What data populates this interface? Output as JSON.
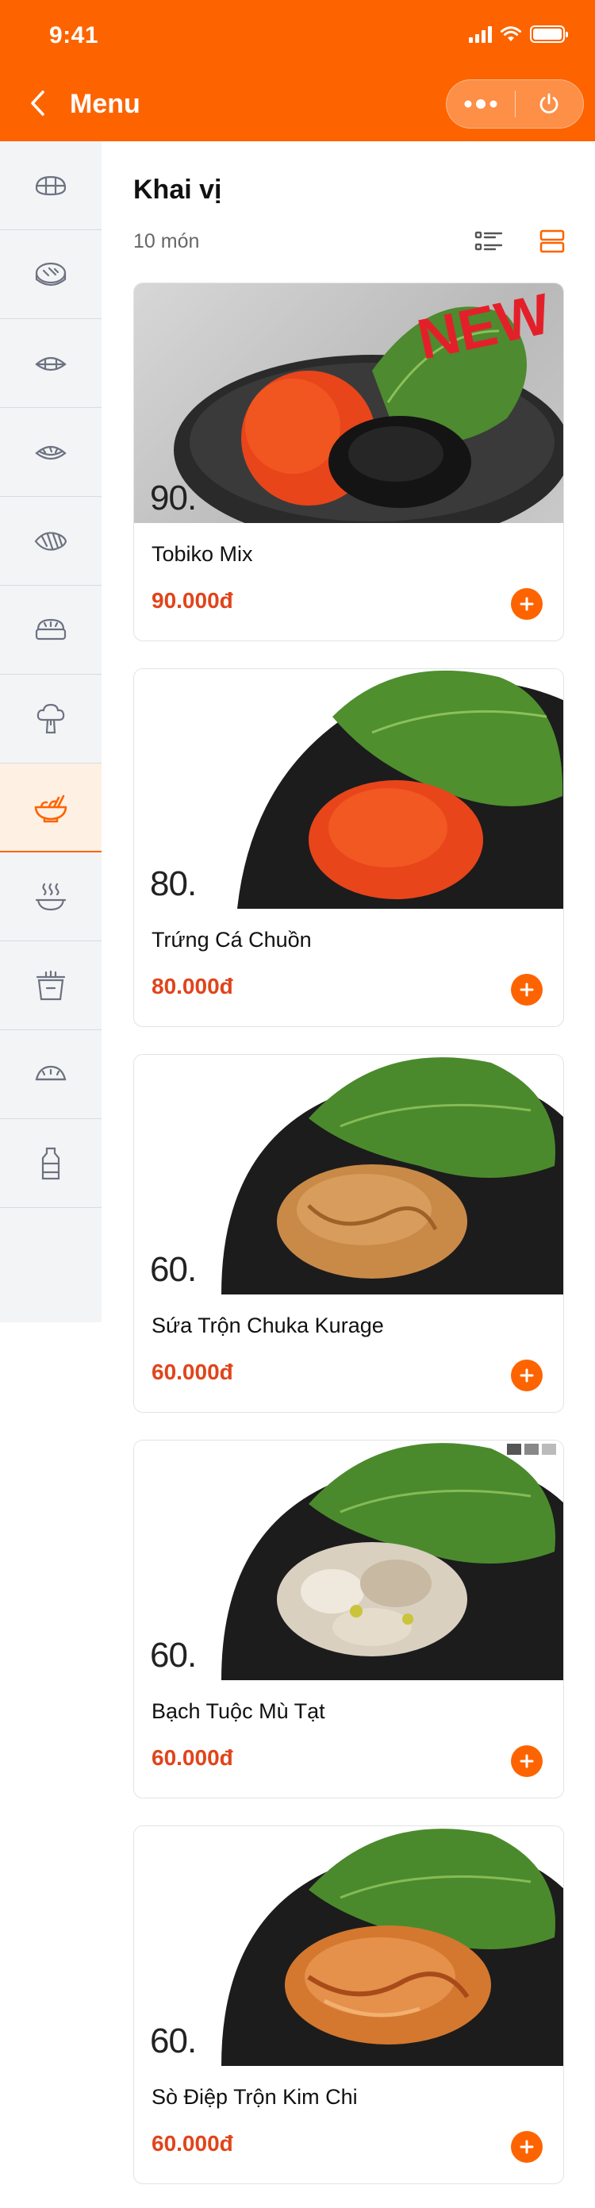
{
  "status_bar": {
    "time": "9:41"
  },
  "header": {
    "title": "Menu",
    "back_icon": "chevron-left-icon",
    "more_icon": "more-dots-icon",
    "power_icon": "power-icon"
  },
  "categories": [
    {
      "icon": "sushi-roll-icon",
      "active": false
    },
    {
      "icon": "maki-icon",
      "active": false
    },
    {
      "icon": "nigiri-icon",
      "active": false
    },
    {
      "icon": "sashimi-icon",
      "active": false
    },
    {
      "icon": "fish-icon",
      "active": false
    },
    {
      "icon": "bento-icon",
      "active": false
    },
    {
      "icon": "broccoli-icon",
      "active": false
    },
    {
      "icon": "salad-bowl-icon",
      "active": true
    },
    {
      "icon": "hot-dish-icon",
      "active": false
    },
    {
      "icon": "takeaway-box-icon",
      "active": false
    },
    {
      "icon": "dumpling-icon",
      "active": false
    },
    {
      "icon": "bottle-icon",
      "active": false
    }
  ],
  "section": {
    "title": "Khai vị",
    "count": "10 món",
    "list_view_icon": "list-view-icon",
    "card_view_icon": "card-view-icon"
  },
  "products": [
    {
      "name": "Tobiko Mix",
      "price": "90.000đ",
      "image_label": "90.",
      "badge": "NEW"
    },
    {
      "name": "Trứng Cá Chuồn",
      "price": "80.000đ",
      "image_label": "80."
    },
    {
      "name": "Sứa Trộn Chuka Kurage",
      "price": "60.000đ",
      "image_label": "60."
    },
    {
      "name": "Bạch Tuộc Mù Tạt",
      "price": "60.000đ",
      "image_label": "60."
    },
    {
      "name": "Sò Điệp Trộn Kim Chi",
      "price": "60.000đ",
      "image_label": "60."
    }
  ],
  "colors": {
    "brand": "#fd6400",
    "price": "#e1441b",
    "sidebar_bg": "#f3f4f6",
    "active_bg": "#fff0e4"
  }
}
